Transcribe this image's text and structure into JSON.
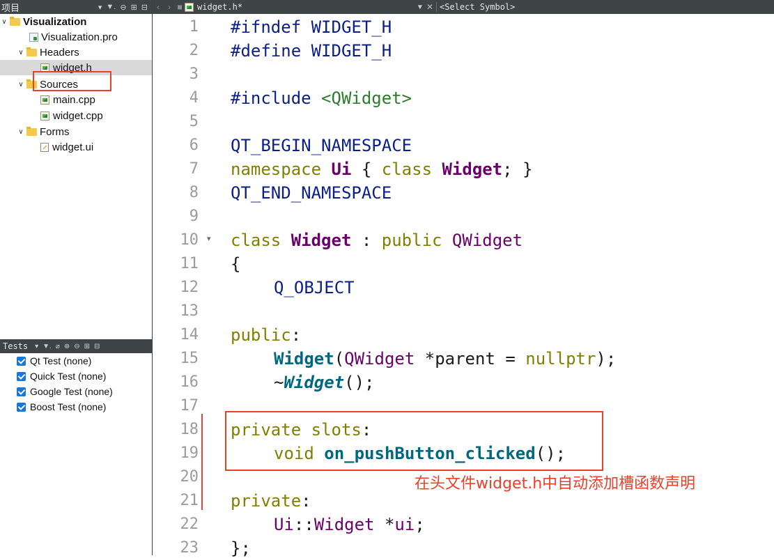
{
  "project_panel": {
    "title": "项目",
    "tool_icons": [
      "filter-icon",
      "link-icon",
      "split-icon",
      "close-pane-icon"
    ]
  },
  "editor_toolbar": {
    "back": "‹",
    "forward": "›",
    "file_name": "widget.h*",
    "symbol_placeholder": "<Select Symbol>"
  },
  "tree": {
    "root": "Visualization",
    "pro_file": "Visualization.pro",
    "headers": "Headers",
    "header_file": "widget.h",
    "sources": "Sources",
    "source_files": [
      "main.cpp",
      "widget.cpp"
    ],
    "forms": "Forms",
    "form_file": "widget.ui"
  },
  "tests_panel": {
    "title": "Tests",
    "items": [
      "Qt Test (none)",
      "Quick Test (none)",
      "Google Test (none)",
      "Boost Test (none)"
    ]
  },
  "code": {
    "line_numbers": [
      "1",
      "2",
      "3",
      "4",
      "5",
      "6",
      "7",
      "8",
      "9",
      "10",
      "11",
      "12",
      "13",
      "14",
      "15",
      "16",
      "17",
      "18",
      "19",
      "20",
      "21",
      "22",
      "23"
    ],
    "l1a": "#ifndef",
    "l1b": " WIDGET_H",
    "l2a": "#define",
    "l2b": " WIDGET_H",
    "l4a": "#include",
    "l4b": "<QWidget>",
    "l6": "QT_BEGIN_NAMESPACE",
    "l7_namespace": "namespace",
    "l7_ui": "Ui",
    "l7_brace": " { ",
    "l7_class": "class",
    "l7_widget": "Widget",
    "l7_end": "; }",
    "l8": "QT_END_NAMESPACE",
    "l10_class": "class",
    "l10_widget": "Widget",
    "l10_colon": " : ",
    "l10_public": "public",
    "l10_base": "QWidget",
    "l11": "{",
    "l12": "Q_OBJECT",
    "l14_public": "public",
    "l14_colon": ":",
    "l15_ctor": "Widget",
    "l15_open": "(",
    "l15_type": "QWidget",
    "l15_rest": " *parent = ",
    "l15_null": "nullptr",
    "l15_end": ");",
    "l16_tilde": "~",
    "l16_dtor": "Widget",
    "l16_end": "();",
    "l18_private": "private",
    "l18_slots": "slots",
    "l18_colon": ":",
    "l19_void": "void",
    "l19_method": "on_pushButton_clicked",
    "l19_end": "();",
    "l21_private": "private",
    "l21_colon": ":",
    "l22_ns": "Ui",
    "l22_sep": "::",
    "l22_type": "Widget",
    "l22_rest": " *",
    "l22_var": "ui",
    "l22_end": ";",
    "l23": "};"
  },
  "annotation": "在头文件widget.h中自动添加槽函数声明",
  "colors": {
    "annotation": "#e8402a",
    "toolbar": "#3f4447",
    "selection": "#d9d9d9"
  }
}
